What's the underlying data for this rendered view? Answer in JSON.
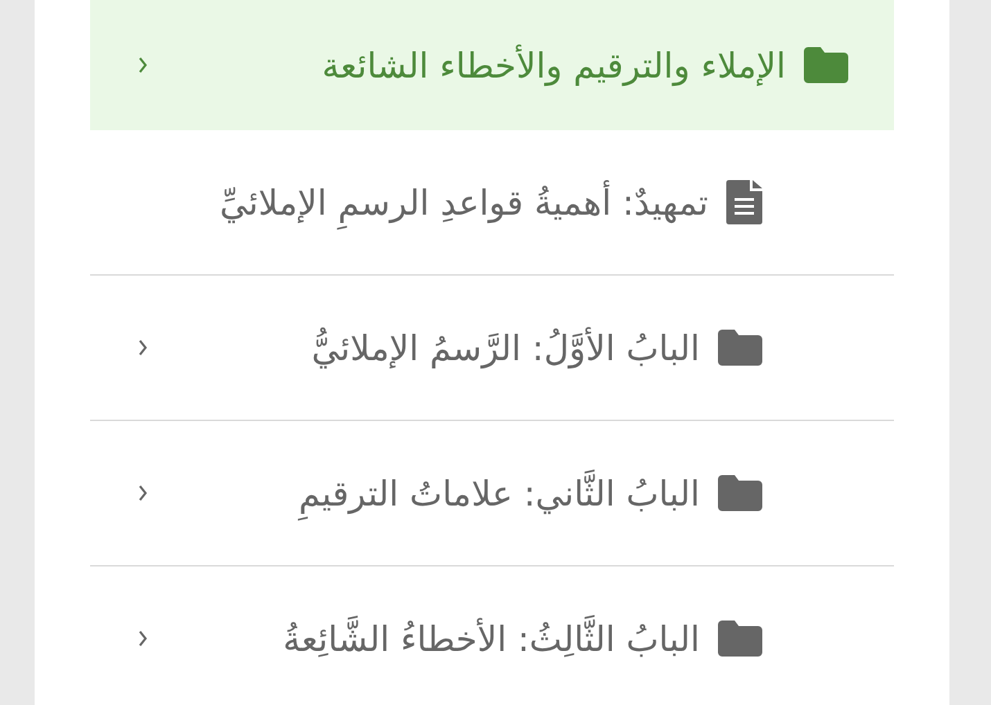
{
  "tree": {
    "label": "الإملاء والترقيم والأخطاء الشائعة",
    "kind": "folder",
    "selected": true,
    "children": [
      {
        "label": "تمهيدٌ: أهميةُ قواعدِ الرسمِ الإملائيِّ",
        "kind": "file",
        "selected": false
      },
      {
        "label": "البابُ الأوَّلُ: الرَّسمُ الإملائيُّ",
        "kind": "folder",
        "selected": false
      },
      {
        "label": "البابُ الثَّاني: علاماتُ الترقيمِ",
        "kind": "folder",
        "selected": false
      },
      {
        "label": "البابُ الثَّالِثُ: الأخطاءُ الشَّائِعةُ",
        "kind": "folder",
        "selected": false
      }
    ]
  }
}
